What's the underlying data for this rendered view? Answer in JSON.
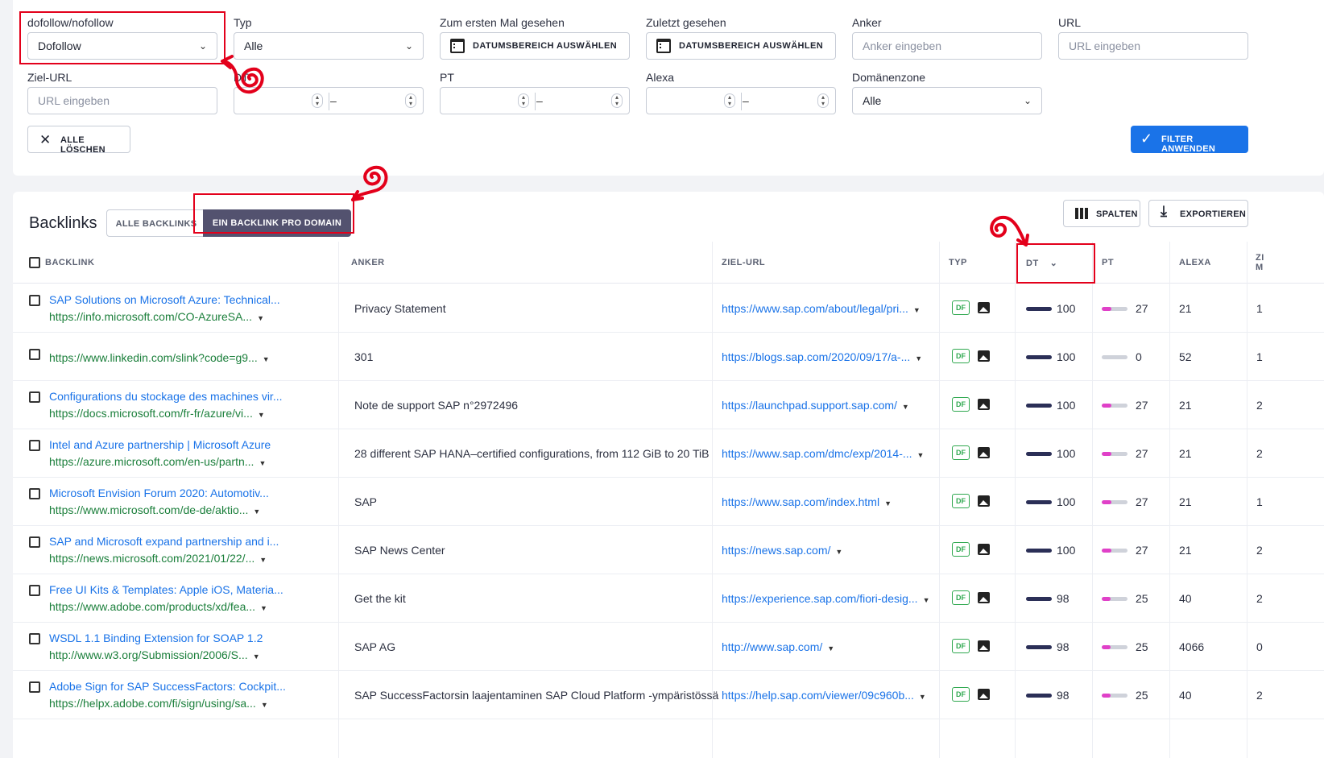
{
  "filters": {
    "dofollow": {
      "label": "dofollow/nofollow",
      "value": "Dofollow"
    },
    "typ": {
      "label": "Typ",
      "value": "Alle"
    },
    "first_seen": {
      "label": "Zum ersten Mal gesehen",
      "value": "DATUMSBEREICH AUSWÄHLEN"
    },
    "last_seen": {
      "label": "Zuletzt gesehen",
      "value": "DATUMSBEREICH AUSWÄHLEN"
    },
    "anchor": {
      "label": "Anker",
      "placeholder": "Anker eingeben"
    },
    "url": {
      "label": "URL",
      "placeholder": "URL eingeben"
    },
    "target_url": {
      "label": "Ziel-URL",
      "placeholder": "URL eingeben"
    },
    "dt": {
      "label": "DT"
    },
    "pt": {
      "label": "PT"
    },
    "alexa": {
      "label": "Alexa"
    },
    "zone": {
      "label": "Domänenzone",
      "value": "Alle"
    },
    "range_dash": "–",
    "clear_all": "ALLE LÖSCHEN",
    "apply": "FILTER ANWENDEN"
  },
  "backlinks": {
    "title": "Backlinks",
    "tab_all": "ALLE BACKLINKS",
    "tab_one_per_domain": "EIN BACKLINK PRO DOMAIN",
    "columns_button": "SPALTEN",
    "export_button": "EXPORTIEREN",
    "headers": {
      "backlink": "BACKLINK",
      "anchor": "ANKER",
      "target": "ZIEL-URL",
      "type": "TYP",
      "dt": "DT",
      "pt": "PT",
      "alexa": "ALEXA",
      "last_a": "ZI",
      "last_b": "M"
    },
    "df_badge": "DF",
    "rows": [
      {
        "title": "SAP Solutions on Microsoft Azure: Technical...",
        "url": "https://info.microsoft.com/CO-AzureSA...",
        "anchor": "Privacy Statement",
        "target": "https://www.sap.com/about/legal/pri...",
        "dt": "100",
        "pt": "27",
        "pt_frac": 0.27,
        "alexa": "21",
        "last": "1"
      },
      {
        "title": "",
        "url": "https://www.linkedin.com/slink?code=g9...",
        "anchor": "301",
        "target": "https://blogs.sap.com/2020/09/17/a-...",
        "dt": "100",
        "pt": "0",
        "pt_frac": 0,
        "alexa": "52",
        "last": "1"
      },
      {
        "title": "Configurations du stockage des machines vir...",
        "url": "https://docs.microsoft.com/fr-fr/azure/vi...",
        "anchor": "Note de support SAP n°2972496",
        "target": "https://launchpad.support.sap.com/",
        "dt": "100",
        "pt": "27",
        "pt_frac": 0.27,
        "alexa": "21",
        "last": "2"
      },
      {
        "title": "Intel and Azure partnership | Microsoft Azure",
        "url": "https://azure.microsoft.com/en-us/partn...",
        "anchor": "28 different SAP HANA–certified configurations, from 112 GiB to 20 TiB",
        "target": "https://www.sap.com/dmc/exp/2014-...",
        "dt": "100",
        "pt": "27",
        "pt_frac": 0.27,
        "alexa": "21",
        "last": "2"
      },
      {
        "title": "Microsoft Envision Forum 2020: Automotiv...",
        "url": "https://www.microsoft.com/de-de/aktio...",
        "anchor": "SAP",
        "target": "https://www.sap.com/index.html",
        "dt": "100",
        "pt": "27",
        "pt_frac": 0.27,
        "alexa": "21",
        "last": "1"
      },
      {
        "title": "SAP and Microsoft expand partnership and i...",
        "url": "https://news.microsoft.com/2021/01/22/...",
        "anchor": "SAP News Center",
        "target": "https://news.sap.com/",
        "dt": "100",
        "pt": "27",
        "pt_frac": 0.27,
        "alexa": "21",
        "last": "2"
      },
      {
        "title": "Free UI Kits & Templates: Apple iOS, Materia...",
        "url": "https://www.adobe.com/products/xd/fea...",
        "anchor": "Get the kit",
        "target": "https://experience.sap.com/fiori-desig...",
        "dt": "98",
        "pt": "25",
        "pt_frac": 0.25,
        "alexa": "40",
        "last": "2"
      },
      {
        "title": "WSDL 1.1 Binding Extension for SOAP 1.2",
        "url": "http://www.w3.org/Submission/2006/S...",
        "anchor": "SAP AG",
        "target": "http://www.sap.com/",
        "dt": "98",
        "pt": "25",
        "pt_frac": 0.25,
        "alexa": "4066",
        "last": "0"
      },
      {
        "title": "Adobe Sign for SAP SuccessFactors: Cockpit...",
        "url": "https://helpx.adobe.com/fi/sign/using/sa...",
        "anchor": "SAP SuccessFactorsin laajentaminen SAP Cloud Platform -ympäristössä",
        "target": "https://help.sap.com/viewer/09c960b...",
        "dt": "98",
        "pt": "25",
        "pt_frac": 0.25,
        "alexa": "40",
        "last": "2"
      }
    ]
  },
  "colors": {
    "accent": "#1a73e8",
    "active_tab": "#53526f",
    "annotation": "#e3001b",
    "df_green": "#2fa84f",
    "url_green": "#1b7f3b",
    "pt_fill": "#e040c8"
  },
  "icons": [
    "chevron-down-icon",
    "calendar-icon",
    "spinner-arrows-icon",
    "close-icon",
    "check-icon",
    "columns-icon",
    "download-icon",
    "image-icon",
    "caret-down-icon",
    "sort-desc-icon",
    "red-swirl-arrow-icon"
  ]
}
